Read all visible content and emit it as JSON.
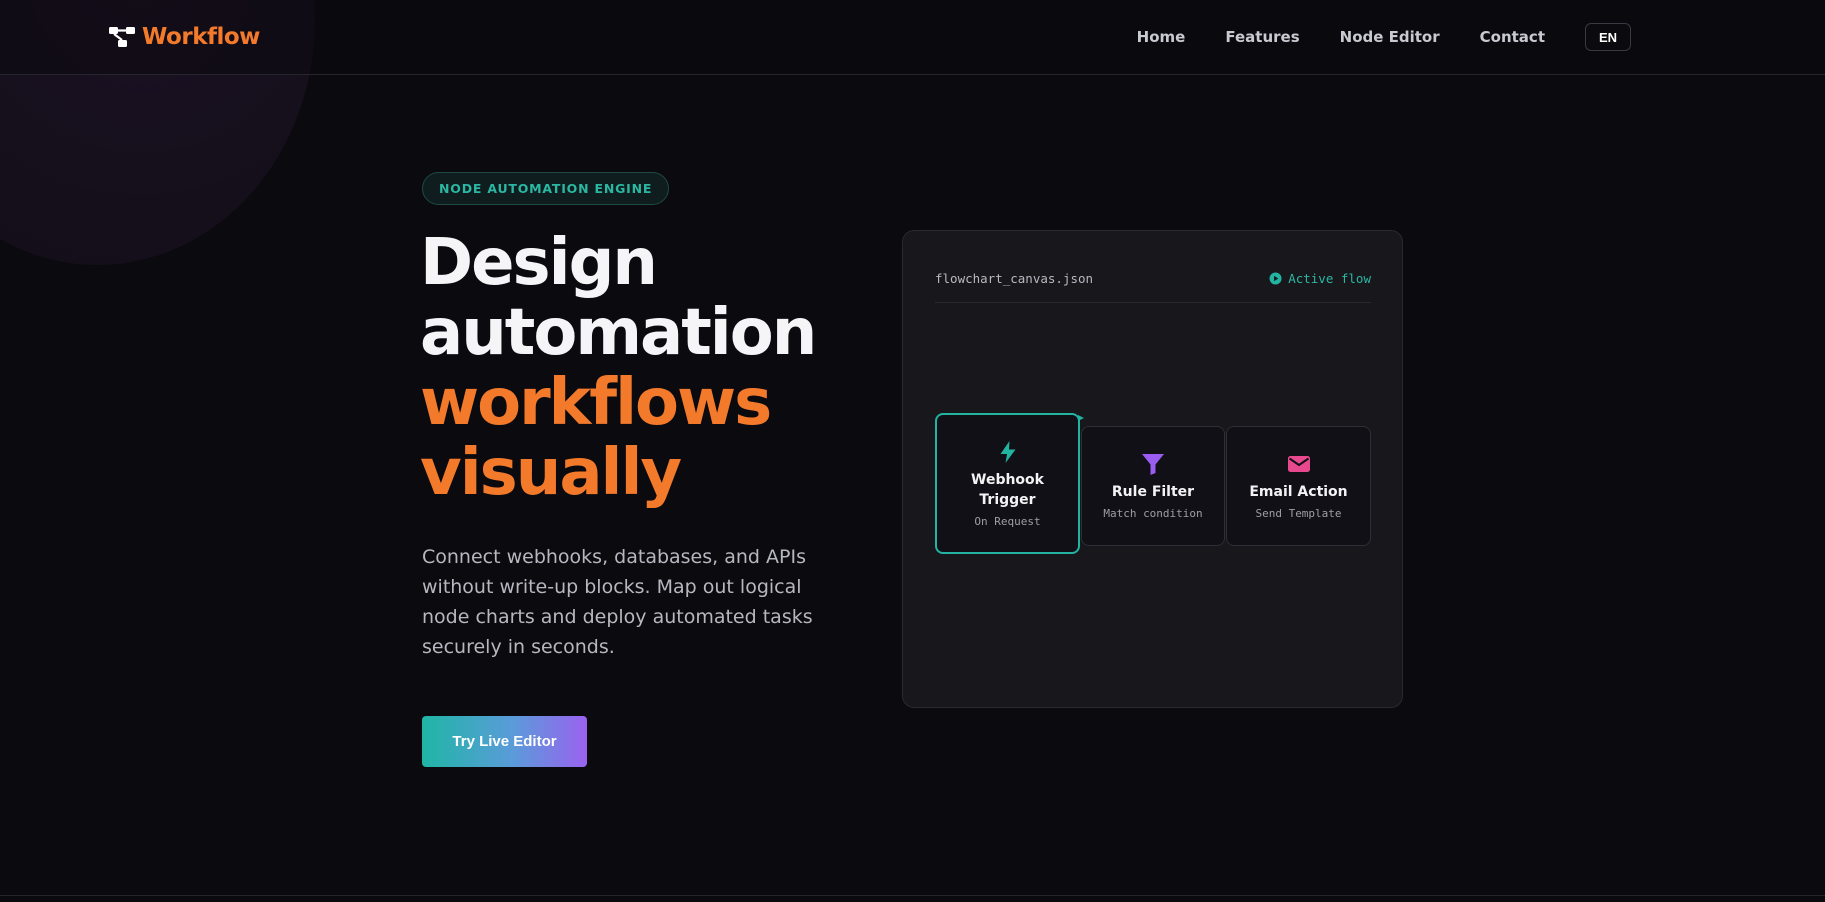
{
  "brand": {
    "name": "Workflow",
    "accent": "#f47a2b"
  },
  "nav": {
    "items": [
      {
        "label": "Home"
      },
      {
        "label": "Features"
      },
      {
        "label": "Node Editor"
      },
      {
        "label": "Contact"
      }
    ],
    "language": "EN"
  },
  "hero": {
    "badge": "NODE AUTOMATION ENGINE",
    "headline_lines": [
      "Design",
      "automation",
      "workflows",
      "visually"
    ],
    "description": "Connect webhooks, databases, and APIs without write-up blocks. Map out logical node charts and deploy automated tasks securely in seconds.",
    "cta_label": "Try Live Editor"
  },
  "canvas": {
    "filename": "flowchart_canvas.json",
    "status": "Active flow",
    "status_icon": "play-circle-icon",
    "nodes": [
      {
        "title": "Webhook Trigger",
        "subtitle": "On Request",
        "icon": "lightning-icon",
        "color": "#22b3a1",
        "active": true
      },
      {
        "title": "Rule Filter",
        "subtitle": "Match condition",
        "icon": "funnel-icon",
        "color": "#9b5cf0",
        "active": false
      },
      {
        "title": "Email Action",
        "subtitle": "Send Template",
        "icon": "envelope-icon",
        "color": "#e8498e",
        "active": false
      }
    ]
  },
  "colors": {
    "teal": "#22b3a1",
    "purple": "#9b5cf0",
    "pink": "#e8498e",
    "background": "#0b0a0f"
  }
}
